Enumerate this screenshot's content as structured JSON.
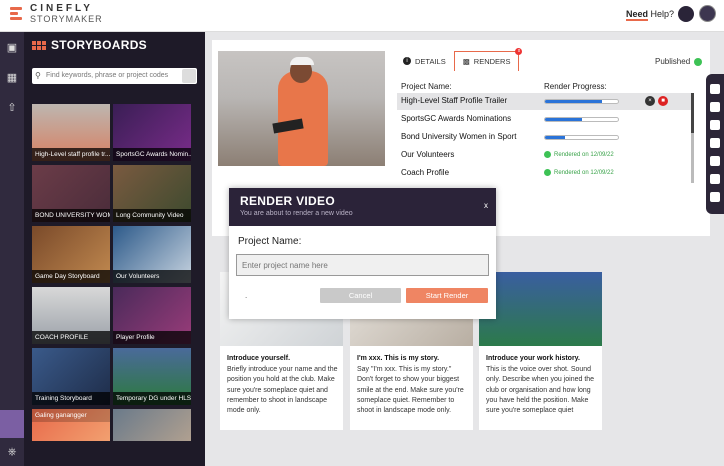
{
  "app": {
    "brand_line1": "CINEFLY",
    "brand_line2": "STORYMAKER",
    "help_prefix": "Need",
    "help_suffix": "Help?"
  },
  "sidebar": {
    "title": "STORYBOARDS",
    "search_placeholder": "Find keywords, phrase or project codes",
    "items": [
      {
        "label": "High-Level staff profile tr..."
      },
      {
        "label": "SportsGC Awards Nomin..."
      },
      {
        "label": "BOND UNIVERSITY WOMEN..."
      },
      {
        "label": "Long Community Video"
      },
      {
        "label": "Game Day Storyboard"
      },
      {
        "label": "Our Volunteers"
      },
      {
        "label": "COACH PROFILE"
      },
      {
        "label": "Player Profile"
      },
      {
        "label": "Training Storyboard"
      },
      {
        "label": "Temporary DG under HLS..."
      },
      {
        "label": "Galing ganangger"
      },
      {
        "label": ""
      }
    ]
  },
  "detail": {
    "tab_details": "DETAILS",
    "tab_renders": "RENDERS",
    "renders_badge": "x",
    "status": "Published",
    "col_name": "Project Name:",
    "col_progress": "Render Progress:",
    "rows": [
      {
        "name": "High-Level Staff Profile Trailer",
        "progress": 0.78,
        "status": ""
      },
      {
        "name": "SportsGC Awards Nominations",
        "progress": 0.5,
        "status": ""
      },
      {
        "name": "Bond University Women in Sport",
        "progress": 0.28,
        "status": ""
      },
      {
        "name": "Our Volunteers",
        "progress": 1,
        "status": "Rendered on 12/09/22"
      },
      {
        "name": "Coach Profile",
        "progress": 1,
        "status": "Rendered on 12/09/22"
      }
    ]
  },
  "cards": [
    {
      "title": "Introduce yourself.",
      "body": "Briefly introduce your name and the position you hold at the club. Make sure you're someplace quiet and remember to shoot in landscape mode only."
    },
    {
      "title": "I'm xxx. This is my story.",
      "body": "Say \"I'm xxx. This is my story.\" Don't forget to show your biggest smile at the end. Make sure you're someplace quiet. Remember to shoot in landscape mode only."
    },
    {
      "title": "Introduce your work history.",
      "body": "This is the voice over shot. Sound only. Describe when you joined the club or organisation and how long you have held the position. Make sure you're someplace quiet"
    }
  ],
  "modal": {
    "title": "RENDER VIDEO",
    "subtitle": "You are about to render a new video",
    "close": "x",
    "label": "Project Name:",
    "placeholder": "Enter project name here",
    "dot": ".",
    "cancel": "Cancel",
    "start": "Start Render"
  },
  "colors": {
    "accent": "#e8694a",
    "dark": "#2b2339",
    "sidebar": "#1e1a28",
    "progress": "#2a73d8",
    "success": "#3dc255"
  }
}
